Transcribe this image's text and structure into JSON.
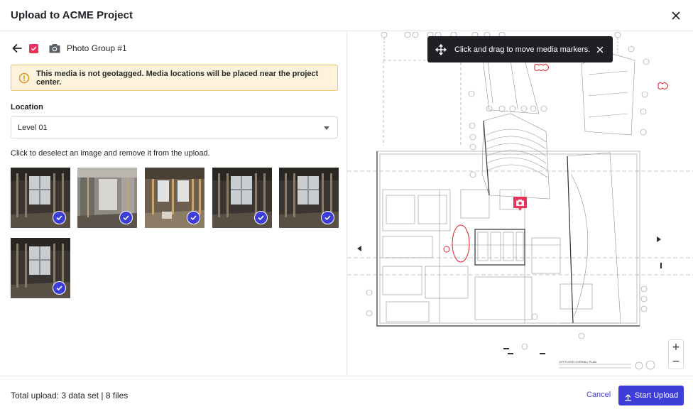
{
  "header": {
    "title": "Upload to ACME Project",
    "close_icon": "close-icon"
  },
  "group": {
    "back_icon": "arrow-left-icon",
    "checked": true,
    "camera_icon": "camera-icon",
    "name": "Photo Group #1"
  },
  "warning": {
    "icon": "warning-icon",
    "text": "This media is not geotagged. Media locations will be placed near the project center."
  },
  "location": {
    "label": "Location",
    "value": "Level 01"
  },
  "hint": "Click to deselect an image and remove it from the upload.",
  "images": [
    {
      "selected": true
    },
    {
      "selected": true
    },
    {
      "selected": true
    },
    {
      "selected": true
    },
    {
      "selected": true
    },
    {
      "selected": true
    }
  ],
  "map": {
    "toast_text": "Click and drag to move media markers.",
    "plan_caption": "1ST FLOOR OVERALL PLAN",
    "zoom_in": "+",
    "zoom_out": "−"
  },
  "footer": {
    "total_prefix": "Total upload: 3 data set",
    "total_suffix": "8 files",
    "cancel_label": "Cancel",
    "start_label": "Start Upload"
  },
  "colors": {
    "accent": "#3d3dd8",
    "checkbox": "#e8335a",
    "warning_bg": "#fdf3dc",
    "warning_border": "#f0c36b"
  }
}
